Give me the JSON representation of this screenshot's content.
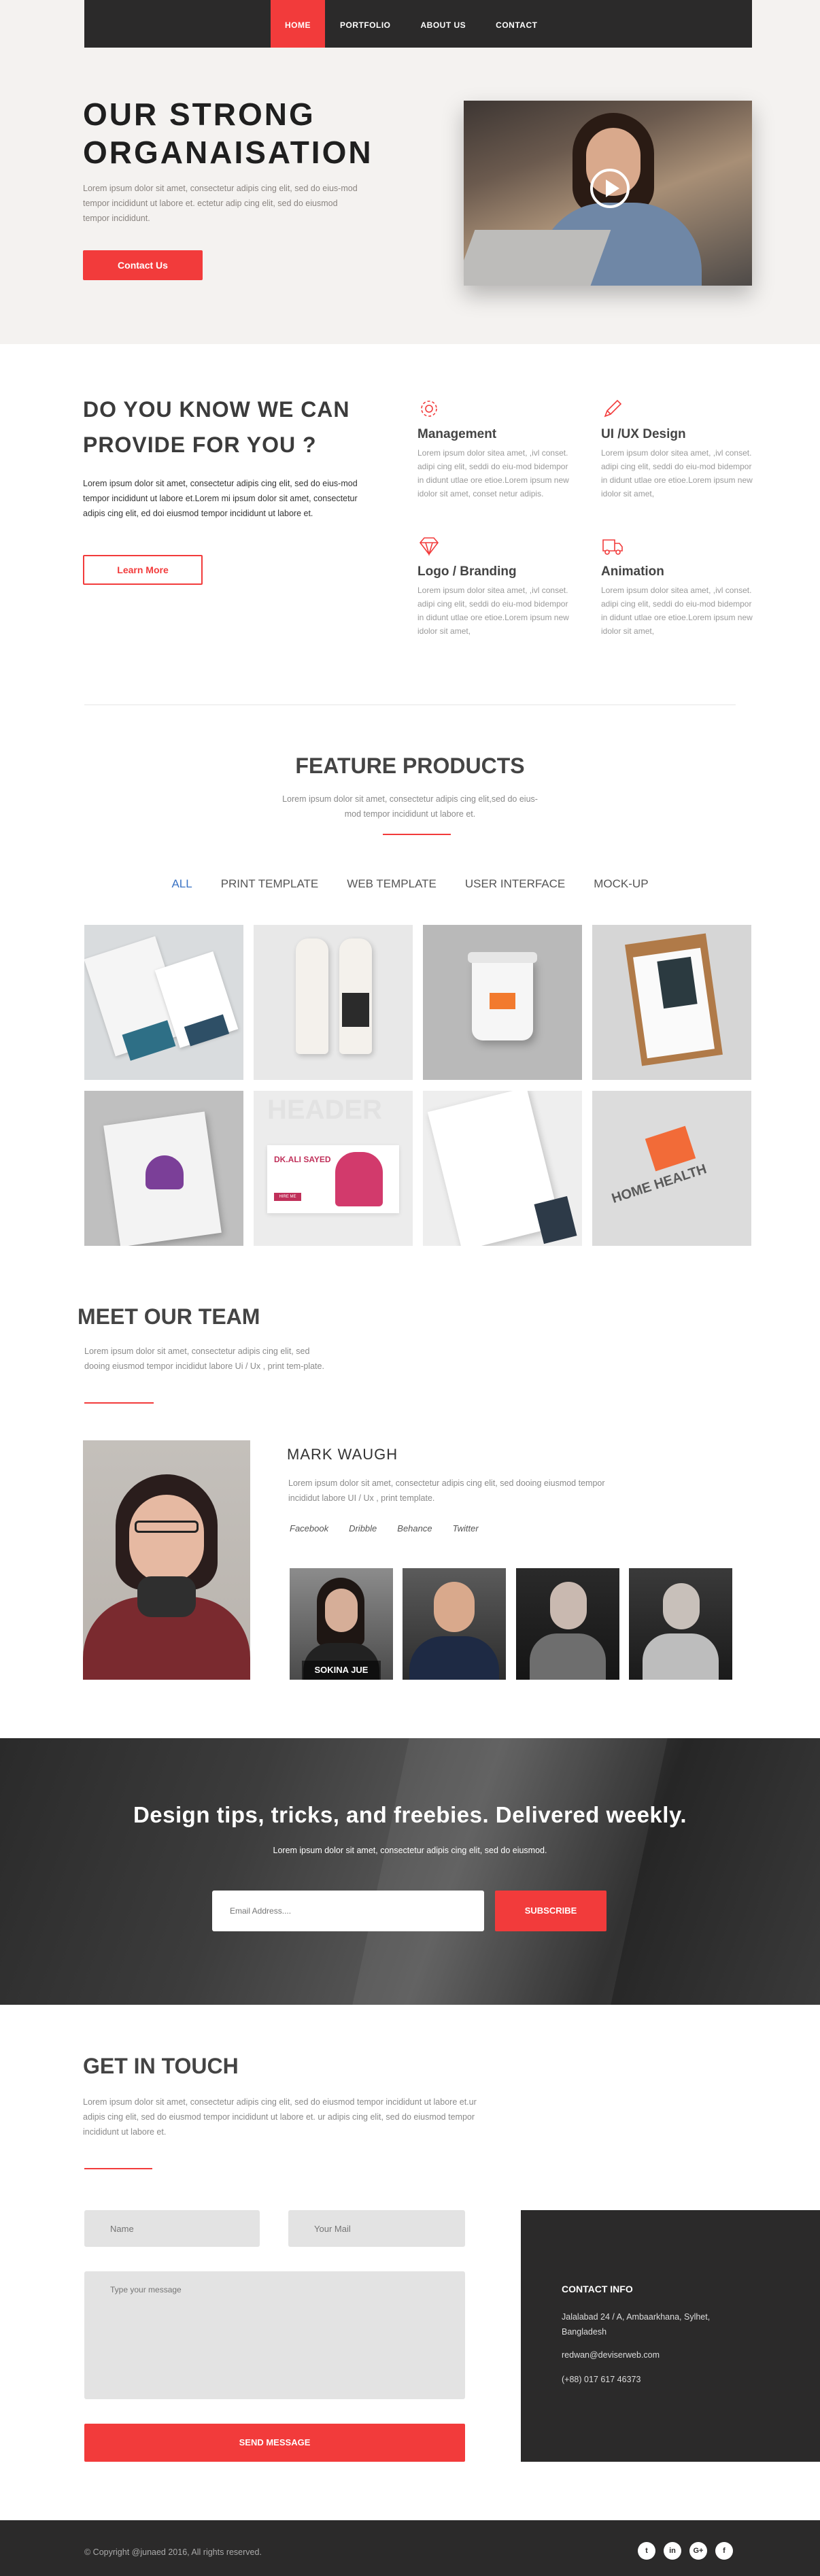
{
  "nav": {
    "items": [
      "HOME",
      "PORTFOLIO",
      "ABOUT US",
      "CONTACT"
    ]
  },
  "hero": {
    "title_line1": "OUR STRONG",
    "title_line2": "ORGANAISATION",
    "text": "Lorem ipsum dolor sit amet, consectetur adipis cing elit, sed do eius-mod tempor incididunt ut labore et. ectetur adip cing elit, sed do eiusmod tempor incididunt.",
    "button": "Contact Us"
  },
  "services": {
    "title_line1": "DO YOU KNOW WE CAN",
    "title_line2": "PROVIDE FOR YOU ?",
    "text": "Lorem ipsum dolor sit amet, consectetur adipis cing elit, sed do eius-mod tempor incididunt ut labore et.Lorem mi ipsum dolor sit amet, consectetur adipis cing elit, ed doi eiusmod tempor incididunt ut labore et.",
    "button": "Learn More",
    "items": [
      {
        "title": "Management",
        "icon": "gear-icon",
        "text": "Lorem ipsum dolor sitea amet, ,ivl conset. adipi cing elit, seddi do eiu-mod bidempor in didunt utlae ore etioe.Lorem ipsum new idolor sit amet, conset netur adipis."
      },
      {
        "title": "UI /UX Design",
        "icon": "pencil-icon",
        "text": "Lorem ipsum dolor sitea amet, ,ivl conset. adipi cing elit, seddi do eiu-mod bidempor in didunt utlae ore etioe.Lorem ipsum new idolor sit amet,"
      },
      {
        "title": "Logo / Branding",
        "icon": "diamond-icon",
        "text": "Lorem ipsum dolor sitea amet, ,ivl conset. adipi cing elit, seddi do eiu-mod bidempor in didunt utlae ore etioe.Lorem ipsum new idolor sit amet,"
      },
      {
        "title": "Animation",
        "icon": "truck-icon",
        "text": "Lorem ipsum dolor sitea amet, ,ivl conset. adipi cing elit, seddi do eiu-mod bidempor in didunt utlae ore etioe.Lorem ipsum new idolor sit amet,"
      }
    ]
  },
  "products": {
    "title": "FEATURE PRODUCTS",
    "text": "Lorem ipsum dolor sit amet, consectetur adipis cing elit,sed do eius-mod tempor incididunt ut labore et.",
    "filters": [
      "ALL",
      "PRINT TEMPLATE",
      "WEB TEMPLATE",
      "USER INTERFACE",
      "MOCK-UP"
    ],
    "tile_texts": {
      "headers": "HEADER",
      "name": "DK.ALI SAYED",
      "cta": "HIRE ME",
      "cup": "HOME HEALTH",
      "brand": "HOME HEALTH"
    }
  },
  "team": {
    "title": "MEET OUR TEAM",
    "text": "Lorem ipsum dolor sit amet, consectetur adipis cing elit, sed dooing eiusmod tempor incididut labore Ui / Ux , print tem-plate.",
    "member_name": "MARK WAUGH",
    "member_bio": "Lorem ipsum dolor sit amet, consectetur adipis cing elit, sed dooing eiusmod tempor incididut labore UI / Ux , print template.",
    "socials": [
      "Facebook",
      "Dribble",
      "Behance",
      "Twitter"
    ],
    "thumb_label": "SOKINA JUE"
  },
  "newsletter": {
    "title": "Design tips, tricks, and freebies. Delivered weekly.",
    "text": "Lorem ipsum dolor sit amet, consectetur adipis cing elit, sed do eiusmod.",
    "placeholder": "Email Address....",
    "button": "SUBSCRIBE"
  },
  "contact": {
    "title": "GET IN TOUCH",
    "text": "Lorem ipsum dolor sit amet, consectetur adipis cing elit, sed do eiusmod tempor incididunt ut labore et.ur adipis cing elit, sed do eiusmod tempor incididunt ut labore et. ur adipis cing elit, sed do eiusmod tempor incididunt ut labore et.",
    "name_placeholder": "Name",
    "mail_placeholder": "Your Mail",
    "message_placeholder": "Type your message",
    "button": "SEND MESSAGE",
    "info_title": "CONTACT INFO",
    "address": "Jalalabad 24 / A, Ambaarkhana, Sylhet, Bangladesh",
    "email": "redwan@deviserweb.com",
    "phone": "(+88) 017 617 46373"
  },
  "footer": {
    "copyright": "© Copyright @junaed 2016, All rights reserved.",
    "social_icons": [
      "twitter-icon",
      "linkedin-icon",
      "google-plus-icon",
      "facebook-icon"
    ],
    "social_glyphs": [
      "t",
      "in",
      "G+",
      "f"
    ]
  },
  "colors": {
    "accent": "#f23b3b",
    "dark": "#2b2a2a",
    "filter_active": "#3a73c4"
  }
}
